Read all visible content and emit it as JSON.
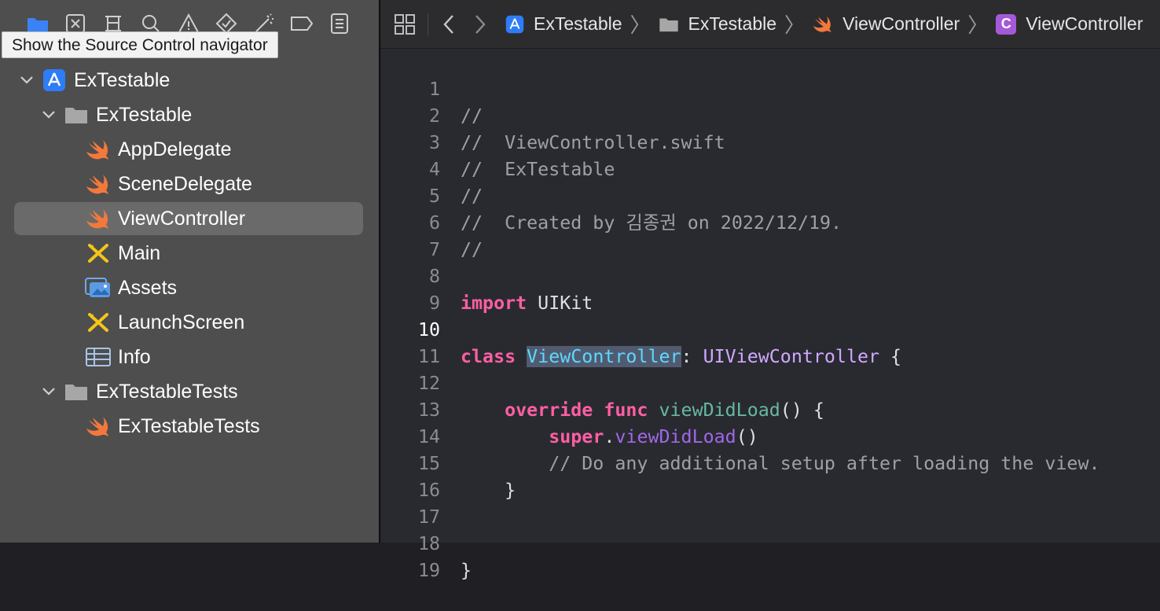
{
  "navigator": {
    "tooltip": "Show the Source Control navigator",
    "toolbar_icons": [
      "folder-icon",
      "source-control-icon",
      "symbol-icon",
      "find-icon",
      "issue-icon",
      "test-icon",
      "debug-icon",
      "breakpoint-icon",
      "report-icon"
    ],
    "tree": [
      {
        "label": "ExTestable",
        "icon": "project-icon",
        "expanded": true
      },
      {
        "label": "ExTestable",
        "icon": "folder-icon",
        "expanded": true
      },
      {
        "label": "AppDelegate",
        "icon": "swift-icon"
      },
      {
        "label": "SceneDelegate",
        "icon": "swift-icon"
      },
      {
        "label": "ViewController",
        "icon": "swift-icon",
        "selected": true
      },
      {
        "label": "Main",
        "icon": "storyboard-icon"
      },
      {
        "label": "Assets",
        "icon": "assets-icon"
      },
      {
        "label": "LaunchScreen",
        "icon": "storyboard-icon"
      },
      {
        "label": "Info",
        "icon": "plist-icon"
      },
      {
        "label": "ExTestableTests",
        "icon": "folder-icon",
        "expanded": true
      },
      {
        "label": "ExTestableTests",
        "icon": "swift-icon"
      }
    ]
  },
  "jumpbar": {
    "crumbs": [
      {
        "label": "ExTestable",
        "icon": "project-icon"
      },
      {
        "label": "ExTestable",
        "icon": "folder-icon"
      },
      {
        "label": "ViewController",
        "icon": "swift-icon"
      },
      {
        "label": "ViewController",
        "icon": "class-icon",
        "icon_letter": "C"
      }
    ],
    "separator": "〉"
  },
  "editor": {
    "current_line": 10,
    "lines": [
      {
        "n": "1",
        "t": "//"
      },
      {
        "n": "2",
        "t": "//  ViewController.swift"
      },
      {
        "n": "3",
        "t": "//  ExTestable"
      },
      {
        "n": "4",
        "t": "//"
      },
      {
        "n": "5",
        "t": "//  Created by 김종권 on 2022/12/19."
      },
      {
        "n": "6",
        "t": "//"
      },
      {
        "n": "7",
        "t": ""
      },
      {
        "n": "8",
        "kw": "import",
        "rest": " UIKit"
      },
      {
        "n": "9",
        "t": ""
      },
      {
        "n": "10",
        "kw": "class",
        "name": "ViewController",
        "colon": ":",
        "super": "UIViewController",
        "brace": " {"
      },
      {
        "n": "11",
        "t": ""
      },
      {
        "n": "12",
        "indent": "    ",
        "kw1": "override",
        "kw2": "func",
        "fn": "viewDidLoad",
        "rest": "() {"
      },
      {
        "n": "13",
        "indent": "        ",
        "kw": "super",
        "dot": ".",
        "call": "viewDidLoad",
        "rest": "()"
      },
      {
        "n": "14",
        "t": "        // Do any additional setup after loading the view."
      },
      {
        "n": "15",
        "t": "    }"
      },
      {
        "n": "16",
        "t": ""
      },
      {
        "n": "17",
        "t": ""
      },
      {
        "n": "18",
        "t": "}"
      },
      {
        "n": "19",
        "t": ""
      }
    ]
  },
  "colors": {
    "keyword": "#fc5fa3",
    "type": "#d0a8ff",
    "function": "#67b7a4",
    "comment": "#9ea0a6",
    "selection": "#515b70",
    "accent": "#3a82f7"
  }
}
